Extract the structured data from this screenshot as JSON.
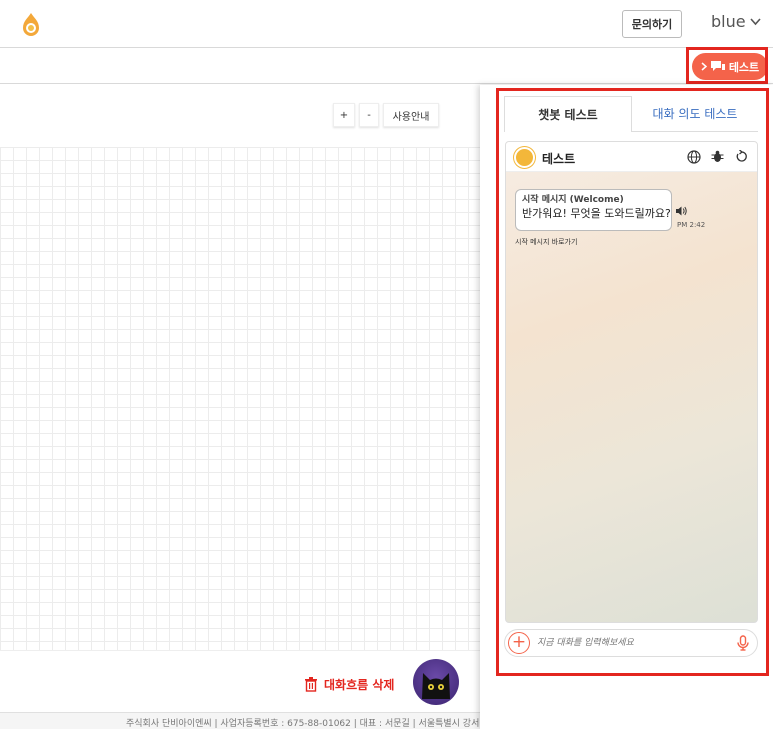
{
  "topbar": {
    "inquiry_label": "문의하기",
    "username": "blue"
  },
  "toolbar": {
    "test_toggle_label": "테스트"
  },
  "canvas": {
    "zoom_in_label": "+",
    "zoom_out_label": "-",
    "guide_label": "사용안내"
  },
  "bottom": {
    "delete_flow_label": "대화흐름 삭제"
  },
  "footer": {
    "text": "주식회사 단비아이엔씨 | 사업자등록번호 : 675-88-01062 | 대표 : 서문길 | 서울특별시 강서"
  },
  "panel": {
    "tabs": [
      {
        "label": "챗봇 테스트"
      },
      {
        "label": "대화 의도 테스트"
      }
    ],
    "chat": {
      "bot_name": "테스트",
      "message_title": "시작 메시지 (Welcome)",
      "message_text": "반가워요! 무엇을 도와드릴까요?",
      "time": "PM 2:42",
      "goto_link": "시작 메시지 바로가기",
      "input_placeholder": "지금 대화를 입력해보세요"
    }
  },
  "colors": {
    "accent": "#f4634a",
    "highlight": "#e3261f",
    "tab_link": "#3a6ec0"
  }
}
